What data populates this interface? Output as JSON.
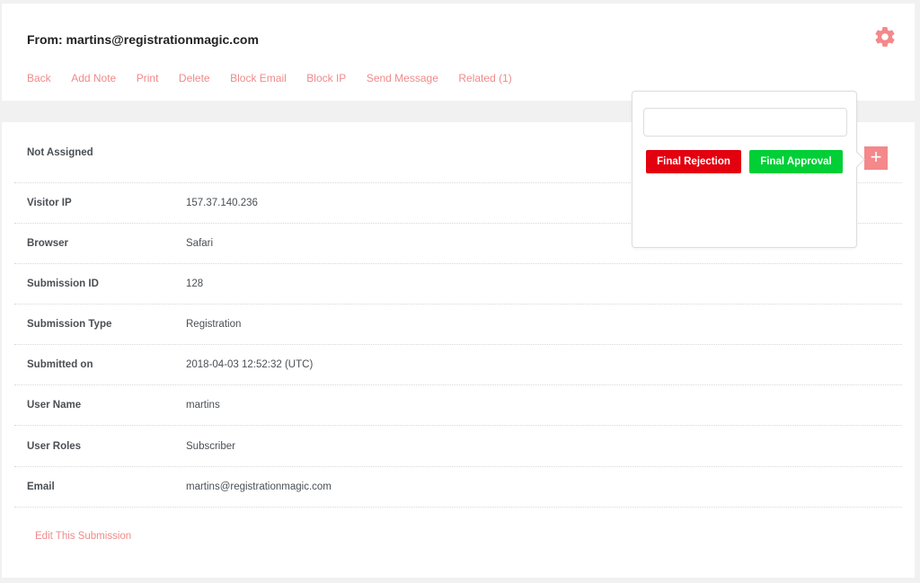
{
  "header": {
    "title": "From: martins@registrationmagic.com",
    "actions": [
      "Back",
      "Add Note",
      "Print",
      "Delete",
      "Block Email",
      "Block IP",
      "Send Message",
      "Related (1)"
    ]
  },
  "assignment": {
    "status": "Not Assigned"
  },
  "details": [
    {
      "label": "Visitor IP",
      "value": "157.37.140.236"
    },
    {
      "label": "Browser",
      "value": "Safari"
    },
    {
      "label": "Submission ID",
      "value": "128"
    },
    {
      "label": "Submission Type",
      "value": "Registration"
    },
    {
      "label": "Submitted on",
      "value": "2018-04-03 12:52:32 (UTC)"
    },
    {
      "label": "User Name",
      "value": "martins"
    },
    {
      "label": "User Roles",
      "value": "Subscriber"
    },
    {
      "label": "Email",
      "value": "martins@registrationmagic.com"
    }
  ],
  "edit_link": "Edit This Submission",
  "popover": {
    "input_value": "",
    "reject_label": "Final Rejection",
    "approve_label": "Final Approval"
  },
  "plus_button": "+",
  "colors": {
    "accent": "#f08a8a",
    "reject": "#e3000f",
    "approve": "#00cf36"
  }
}
